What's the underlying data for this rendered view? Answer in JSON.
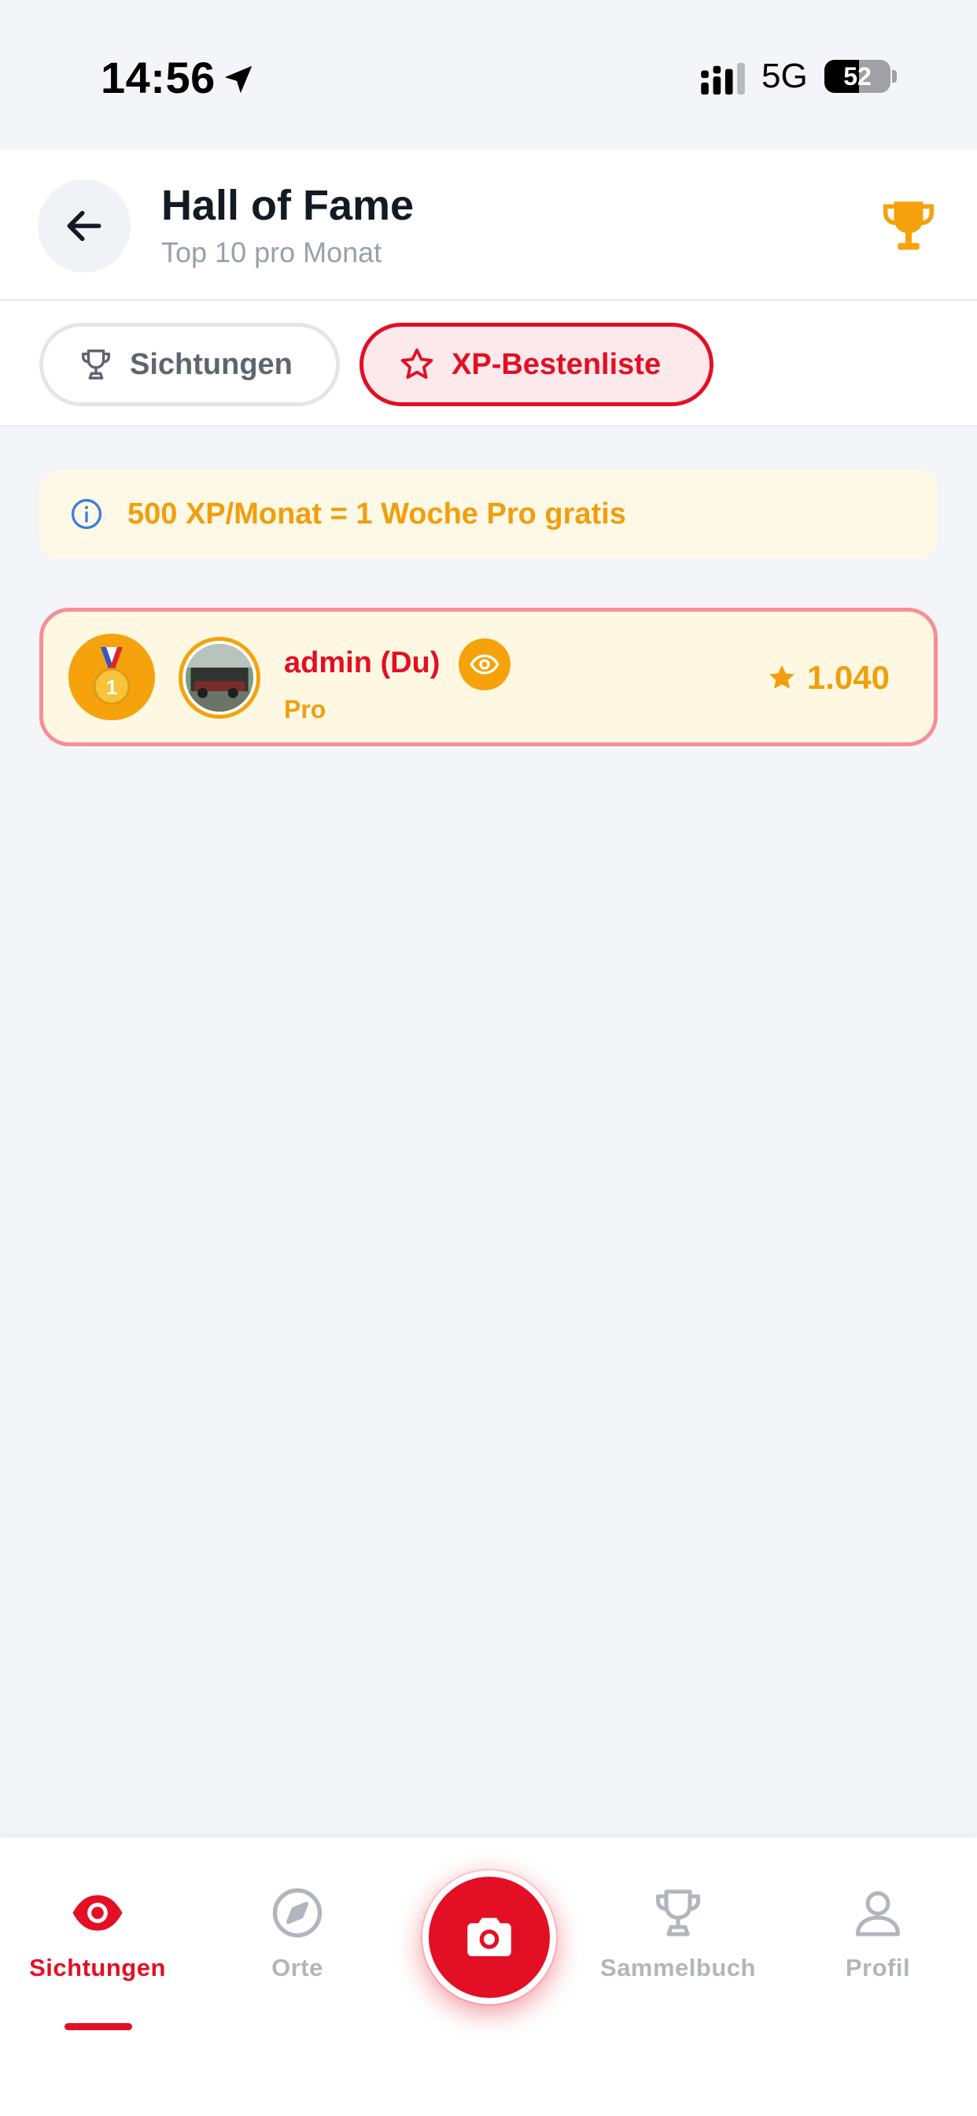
{
  "status_bar": {
    "time": "14:56",
    "network": "5G",
    "battery_level": "52",
    "battery_fraction": 0.52
  },
  "header": {
    "title": "Hall of Fame",
    "subtitle": "Top 10 pro Monat"
  },
  "tabs": [
    {
      "label": "Sichtungen",
      "icon": "trophy-icon",
      "active": false
    },
    {
      "label": "XP-Bestenliste",
      "icon": "star-icon",
      "active": true
    }
  ],
  "info_banner": {
    "icon": "info-icon",
    "text": "500 XP/Monat = 1 Woche Pro gratis"
  },
  "leaderboard": [
    {
      "rank": "1",
      "rank_icon": "gold-medal-icon",
      "name": "admin (Du)",
      "tier": "Pro",
      "badge_icon": "eye-icon",
      "xp": "1.040"
    }
  ],
  "bottom_nav": {
    "items": [
      {
        "label": "Sichtungen",
        "icon": "eye-icon",
        "active": true
      },
      {
        "label": "Orte",
        "icon": "compass-icon",
        "active": false
      },
      {
        "label": "Sammelbuch",
        "icon": "trophy-icon",
        "active": false
      },
      {
        "label": "Profil",
        "icon": "user-icon",
        "active": false
      }
    ],
    "center_action_icon": "camera-icon"
  },
  "colors": {
    "brand_red": "#e30f24",
    "accent_orange": "#f5a20c",
    "text_orange": "#f29e0c",
    "inactive_gray": "#b2b5bd",
    "background": "#f4f5f9"
  }
}
